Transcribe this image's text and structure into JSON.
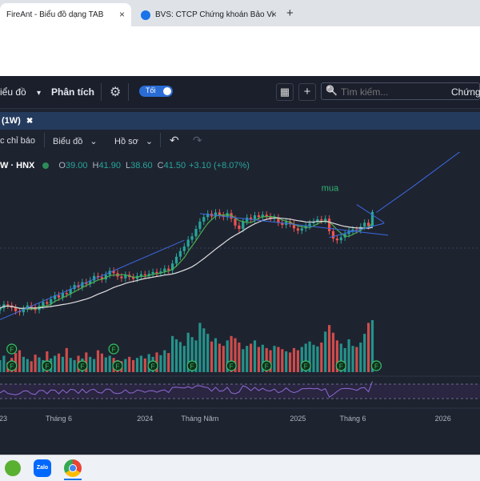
{
  "browser": {
    "tabs": [
      {
        "title": "FireAnt - Biểu đồ dạng TAB",
        "active": true
      },
      {
        "title": "BVS: CTCP Chứng khoán Bảo Vi",
        "active": false
      }
    ],
    "close_glyph": "×",
    "new_tab_glyph": "+"
  },
  "toolbar": {
    "chart_menu": "iểu đồ",
    "chart_menu_caret": "▾",
    "analysis": "Phân tích",
    "settings_icon": "gear-icon",
    "settings_glyph": "⚙",
    "theme_toggle_label": "Tối",
    "grid_glyph": "▦",
    "add_glyph": "+",
    "search_placeholder": "Tìm kiếm...",
    "search_glyph": "🔍",
    "right_label": "Chứng"
  },
  "chart_tab": {
    "label": "(1W)",
    "close_glyph": "✖"
  },
  "chart_toolbar": {
    "indicators": "c chỉ báo",
    "chart_type": "Biểu đồ",
    "profile": "Hồ sơ",
    "caret": "⌄",
    "undo": "↶",
    "redo": "↷"
  },
  "legend": {
    "symbol": "W · HNX",
    "o_label": "O",
    "o": "39.00",
    "h_label": "H",
    "h": "41.90",
    "l_label": "L",
    "l": "38.60",
    "c_label": "C",
    "c": "41.50",
    "change": "+3.10 (+8.07%)"
  },
  "annotation": {
    "text": "mua"
  },
  "event_marker": "F",
  "x_axis_labels": [
    "23",
    "Tháng 6",
    "2024",
    "Tháng Năm",
    "2025",
    "Tháng 6",
    "2026"
  ],
  "colors": {
    "up": "#26a69a",
    "down": "#ef5350",
    "ma_fast": "#4caf50",
    "ma_slow": "#e0e0e0",
    "trendline": "#3b6ae0",
    "rsi": "#8e6bd6",
    "annotation": "#2eb872"
  },
  "chart_data": {
    "type": "candlestick",
    "x_axis_labels": [
      "23",
      "Tháng 6",
      "2024",
      "Tháng Năm",
      "2025",
      "Tháng 6",
      "2026"
    ],
    "last_bar": {
      "open": 39.0,
      "high": 41.9,
      "low": 38.6,
      "close": 41.5,
      "change": 3.1,
      "change_pct": 8.07
    },
    "closes": [
      24.5,
      25.2,
      25.0,
      24.6,
      24.0,
      23.8,
      24.4,
      25.0,
      24.7,
      24.2,
      24.9,
      25.6,
      25.3,
      26.1,
      26.8,
      26.4,
      27.2,
      27.0,
      27.9,
      28.6,
      28.2,
      29.1,
      28.8,
      29.4,
      30.2,
      30.0,
      29.6,
      30.4,
      31.1,
      30.7,
      30.1,
      29.8,
      30.4,
      30.0,
      29.7,
      30.2,
      30.5,
      30.3,
      30.6,
      30.9,
      30.7,
      31.0,
      31.5,
      31.2,
      32.4,
      33.6,
      34.6,
      35.4,
      36.6,
      37.2,
      38.5,
      39.8,
      40.6,
      41.2,
      40.7,
      41.4,
      40.9,
      40.6,
      41.3,
      40.3,
      39.1,
      38.5,
      39.8,
      40.5,
      40.2,
      40.9,
      40.6,
      41.0,
      40.7,
      40.3,
      40.5,
      39.6,
      39.2,
      39.8,
      39.4,
      38.6,
      38.2,
      38.6,
      39.0,
      39.5,
      39.8,
      40.2,
      40.0,
      40.3,
      38.1,
      36.8,
      36.5,
      37.0,
      37.6,
      38.1,
      38.4,
      38.3,
      38.9,
      39.6,
      39.0,
      41.5
    ],
    "volumes": [
      22,
      30,
      18,
      26,
      35,
      40,
      28,
      24,
      20,
      32,
      27,
      22,
      38,
      25,
      30,
      34,
      28,
      44,
      26,
      22,
      30,
      25,
      36,
      28,
      24,
      40,
      34,
      27,
      30,
      26,
      22,
      20,
      24,
      28,
      22,
      26,
      30,
      25,
      33,
      28,
      36,
      31,
      40,
      35,
      66,
      60,
      55,
      48,
      72,
      64,
      58,
      90,
      80,
      70,
      56,
      62,
      52,
      48,
      58,
      66,
      62,
      54,
      42,
      48,
      52,
      58,
      46,
      50,
      44,
      40,
      48,
      46,
      42,
      38,
      36,
      44,
      40,
      46,
      52,
      56,
      50,
      47,
      54,
      74,
      86,
      72,
      58,
      52,
      44,
      60,
      48,
      46,
      54,
      70,
      90,
      95
    ],
    "trendlines": [
      "lower rising support",
      "upper falling resistance",
      "breakout projection"
    ]
  }
}
